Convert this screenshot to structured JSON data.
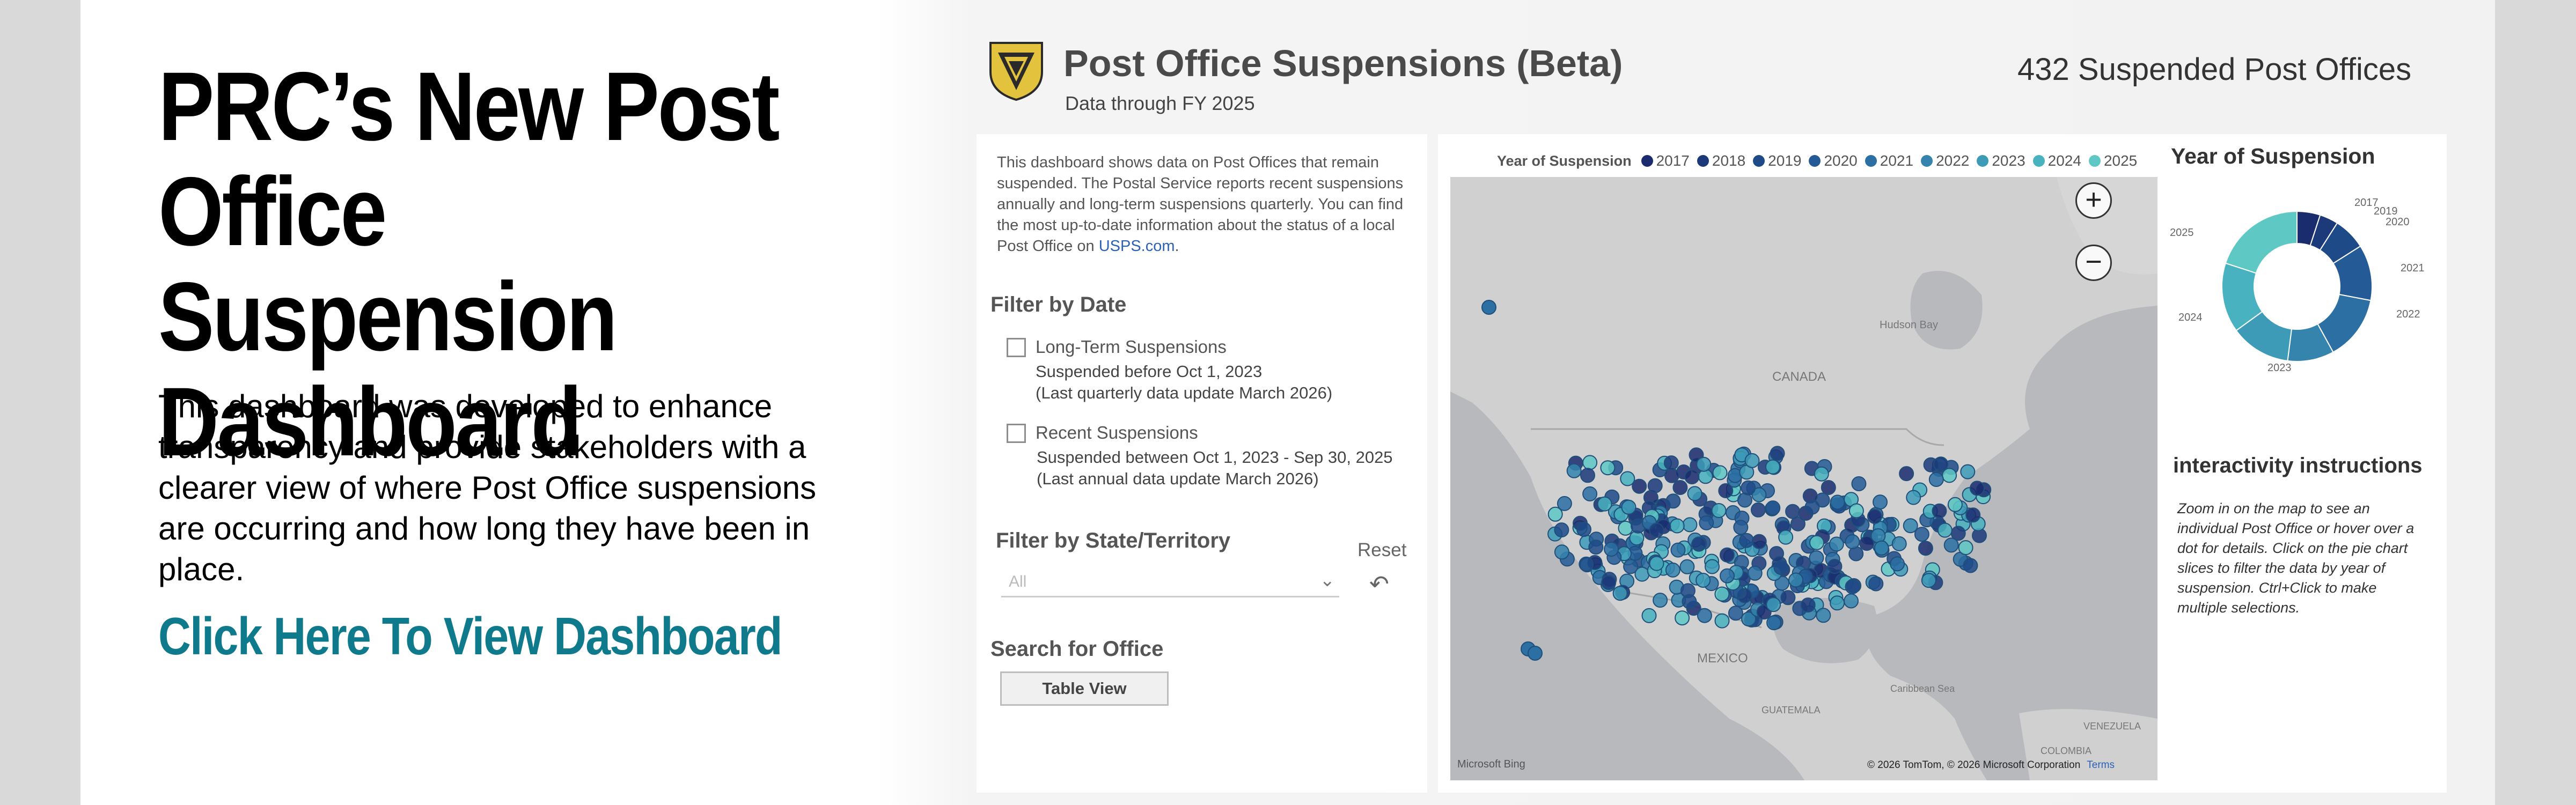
{
  "headline": [
    "PRC’s New Post",
    "Office Suspension",
    "Dashboard"
  ],
  "intro": "This dashboard was developed to enhance transparency and provide stakeholders with a clearer view of where Post Office suspensions are occurring and how long they have been in place.",
  "cta": "Click Here To View Dashboard",
  "dashboard": {
    "logo_icon": "prc-shield-logo",
    "title": "Post Office Suspensions (Beta)",
    "subtitle": "Data through FY 2025",
    "count": "432 Suspended Post Offices",
    "description_pre": "This dashboard shows data on Post Offices that remain suspended. The Postal Service reports recent suspensions annually and long-term suspensions quarterly. You can find the most up-to-date information about the status of a local Post Office on ",
    "description_link": "USPS.com",
    "description_post": ".",
    "filter_by_date": "Filter by Date",
    "long_term": {
      "label": "Long-Term Suspensions",
      "line1": "Suspended before Oct 1, 2023",
      "line2": "(Last quarterly data update March 2026)"
    },
    "recent": {
      "label": "Recent Suspensions",
      "line1": "Suspended between Oct 1, 2023 - Sep 30, 2025",
      "line2": "(Last annual data update March 2026)"
    },
    "filter_by_state": "Filter by State/Territory",
    "reset": "Reset",
    "reset_icon": "undo-arrow-icon",
    "state_select": {
      "value": "All"
    },
    "search_title": "Search for Office",
    "table_view": "Table View",
    "legend": {
      "title": "Year of Suspension",
      "items": [
        {
          "year": "2017",
          "color": "#1a2c6e"
        },
        {
          "year": "2018",
          "color": "#1c3a7a"
        },
        {
          "year": "2019",
          "color": "#1e4a88"
        },
        {
          "year": "2020",
          "color": "#245b96"
        },
        {
          "year": "2021",
          "color": "#2b6fa3"
        },
        {
          "year": "2022",
          "color": "#3484ae"
        },
        {
          "year": "2023",
          "color": "#3d9bb8"
        },
        {
          "year": "2024",
          "color": "#48b2c0"
        },
        {
          "year": "2025",
          "color": "#5ec8c4"
        }
      ]
    },
    "map_labels": {
      "canada": "CANADA",
      "hudson": "Hudson Bay",
      "mexico": "MEXICO",
      "guatemala": "GUATEMALA",
      "caribbean": "Caribbean Sea",
      "colombia": "COLOMBIA",
      "venezuela": "VENEZUELA"
    },
    "map_credit": "© 2026 TomTom, © 2026 Microsoft Corporation",
    "map_terms": "Terms",
    "bing": "Microsoft Bing",
    "zoom_in_icon": "plus-icon",
    "zoom_out_icon": "minus-icon",
    "donut_title": "Year of Suspension",
    "donut_labels": [
      "2017",
      "2019",
      "2020",
      "2021",
      "2022",
      "2023",
      "2024",
      "2025"
    ],
    "instructions_title": "interactivity instructions",
    "instructions_text": "Zoom in on the map to see an individual Post Office or hover over a dot for details. Click on the pie chart slices to filter the data by year of suspension. Ctrl+Click to make multiple selections."
  }
}
